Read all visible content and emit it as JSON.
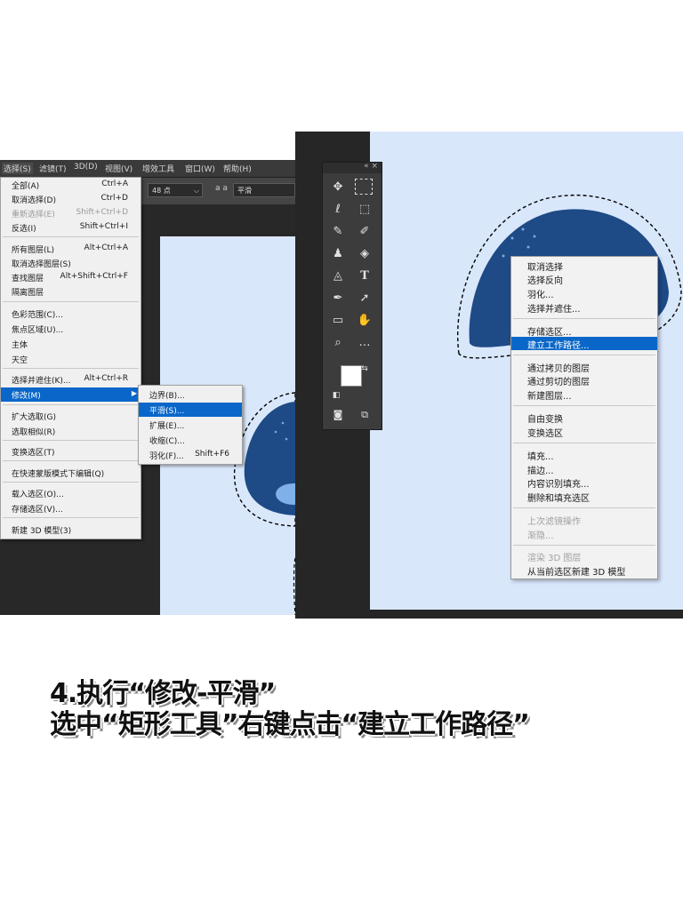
{
  "left": {
    "menubar": [
      "选择(S)",
      "滤镜(T)",
      "3D(D)",
      "视图(V)",
      "增效工具",
      "窗口(W)",
      "帮助(H)"
    ],
    "options": {
      "font_size": "48 点",
      "aa_symbol": "a a",
      "aa_mode": "平滑"
    },
    "select_menu": [
      {
        "label": "全部(A)",
        "shortcut": "Ctrl+A"
      },
      {
        "label": "取消选择(D)",
        "shortcut": "Ctrl+D"
      },
      {
        "label": "重新选择(E)",
        "shortcut": "Shift+Ctrl+D"
      },
      {
        "label": "反选(I)",
        "shortcut": "Shift+Ctrl+I"
      },
      {
        "label": "所有图层(L)",
        "shortcut": "Alt+Ctrl+A"
      },
      {
        "label": "取消选择图层(S)",
        "shortcut": ""
      },
      {
        "label": "查找图层",
        "shortcut": "Alt+Shift+Ctrl+F"
      },
      {
        "label": "隔离图层",
        "shortcut": ""
      },
      {
        "label": "色彩范围(C)...",
        "shortcut": ""
      },
      {
        "label": "焦点区域(U)...",
        "shortcut": ""
      },
      {
        "label": "主体",
        "shortcut": ""
      },
      {
        "label": "天空",
        "shortcut": ""
      },
      {
        "label": "选择并遮住(K)...",
        "shortcut": "Alt+Ctrl+R"
      },
      {
        "label": "修改(M)",
        "shortcut": ""
      },
      {
        "label": "扩大选取(G)",
        "shortcut": ""
      },
      {
        "label": "选取相似(R)",
        "shortcut": ""
      },
      {
        "label": "变换选区(T)",
        "shortcut": ""
      },
      {
        "label": "在快速蒙版模式下编辑(Q)",
        "shortcut": ""
      },
      {
        "label": "载入选区(O)...",
        "shortcut": ""
      },
      {
        "label": "存储选区(V)...",
        "shortcut": ""
      },
      {
        "label": "新建 3D 模型(3)",
        "shortcut": ""
      }
    ],
    "modify_submenu": [
      {
        "label": "边界(B)...",
        "shortcut": ""
      },
      {
        "label": "平滑(S)...",
        "shortcut": ""
      },
      {
        "label": "扩展(E)...",
        "shortcut": ""
      },
      {
        "label": "收缩(C)...",
        "shortcut": ""
      },
      {
        "label": "羽化(F)...",
        "shortcut": "Shift+F6"
      }
    ]
  },
  "right": {
    "toolbar_collapse": "« ×",
    "context_menu": [
      "取消选择",
      "选择反向",
      "羽化...",
      "选择并遮住...",
      "存储选区...",
      "建立工作路径...",
      "通过拷贝的图层",
      "通过剪切的图层",
      "新建图层...",
      "自由变换",
      "变换选区",
      "填充...",
      "描边...",
      "内容识别填充...",
      "删除和填充选区",
      "上次滤镜操作",
      "渐隐...",
      "渲染 3D 图层",
      "从当前选区新建 3D 模型"
    ]
  },
  "caption": {
    "line1": "4.执行“修改-平滑”",
    "line2": "选中“矩形工具”右键点击“建立工作路径”"
  },
  "colors": {
    "highlight": "#0a67c9",
    "canvas": "#d9e7fb",
    "shape_blue": "#1e4a86"
  }
}
